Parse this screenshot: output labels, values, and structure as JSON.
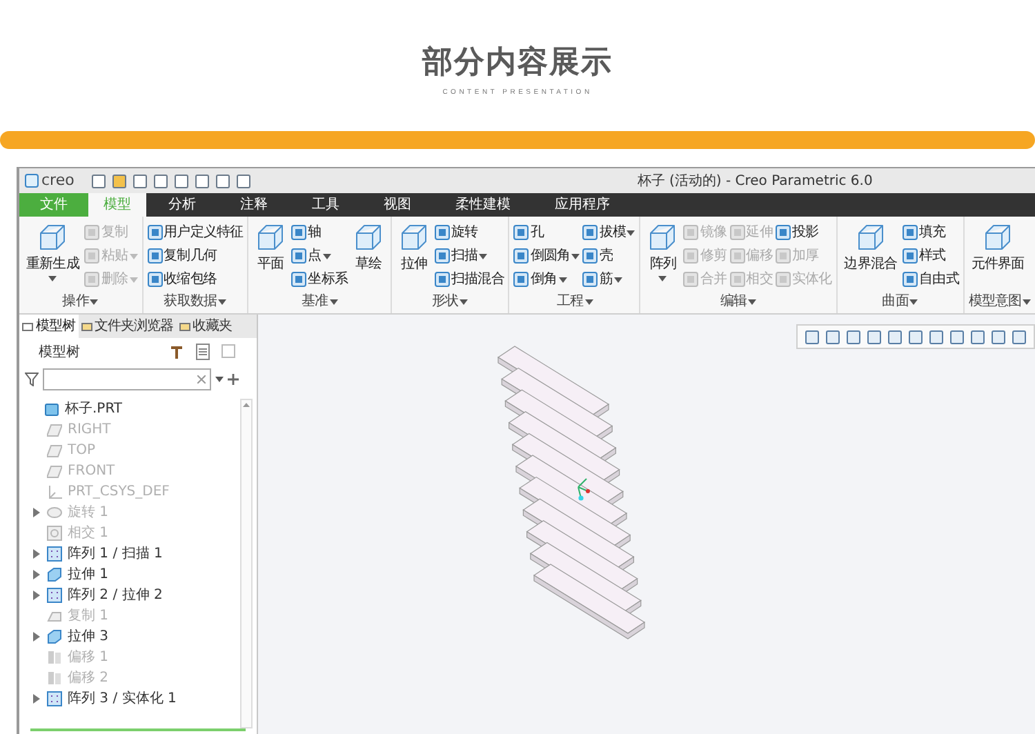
{
  "header": {
    "title": "部分内容展示",
    "subtitle": "CONTENT PRESENTATION"
  },
  "window": {
    "logo": "creo",
    "title": "杯子 (活动的) - Creo Parametric 6.0"
  },
  "tabs": [
    {
      "label": "文件",
      "kind": "file",
      "selected": false
    },
    {
      "label": "模型",
      "kind": "tab",
      "selected": true
    },
    {
      "label": "分析",
      "kind": "tab",
      "selected": false
    },
    {
      "label": "注释",
      "kind": "tab",
      "selected": false
    },
    {
      "label": "工具",
      "kind": "tab",
      "selected": false
    },
    {
      "label": "视图",
      "kind": "tab",
      "selected": false
    },
    {
      "label": "柔性建模",
      "kind": "tab",
      "selected": false
    },
    {
      "label": "应用程序",
      "kind": "tab",
      "selected": false
    }
  ],
  "ribbon": [
    {
      "label": "操作",
      "columns": [
        [
          {
            "label": "重新生成",
            "kind": "large",
            "dropdown": true,
            "disabled": false
          }
        ],
        [
          {
            "label": "复制",
            "kind": "small",
            "dropdown": false,
            "disabled": true
          },
          {
            "label": "粘贴",
            "kind": "small",
            "dropdown": true,
            "disabled": true
          },
          {
            "label": "删除",
            "kind": "small",
            "dropdown": true,
            "disabled": true
          }
        ]
      ]
    },
    {
      "label": "获取数据",
      "columns": [
        [
          {
            "label": "用户定义特征",
            "kind": "small",
            "dropdown": false,
            "disabled": false
          },
          {
            "label": "复制几何",
            "kind": "small",
            "dropdown": false,
            "disabled": false
          },
          {
            "label": "收缩包络",
            "kind": "small",
            "dropdown": false,
            "disabled": false
          }
        ]
      ]
    },
    {
      "label": "基准",
      "columns": [
        [
          {
            "label": "平面",
            "kind": "large",
            "dropdown": false,
            "disabled": false
          }
        ],
        [
          {
            "label": "轴",
            "kind": "small",
            "dropdown": false,
            "disabled": false
          },
          {
            "label": "点",
            "kind": "small",
            "dropdown": true,
            "disabled": false
          },
          {
            "label": "坐标系",
            "kind": "small",
            "dropdown": false,
            "disabled": false
          }
        ],
        [
          {
            "label": "草绘",
            "kind": "large",
            "dropdown": false,
            "disabled": false
          }
        ]
      ]
    },
    {
      "label": "形状",
      "columns": [
        [
          {
            "label": "拉伸",
            "kind": "large",
            "dropdown": false,
            "disabled": false
          }
        ],
        [
          {
            "label": "旋转",
            "kind": "small",
            "dropdown": false,
            "disabled": false
          },
          {
            "label": "扫描",
            "kind": "small",
            "dropdown": true,
            "disabled": false
          },
          {
            "label": "扫描混合",
            "kind": "small",
            "dropdown": false,
            "disabled": false
          }
        ]
      ]
    },
    {
      "label": "工程",
      "columns": [
        [
          {
            "label": "孔",
            "kind": "small",
            "dropdown": false,
            "disabled": false
          },
          {
            "label": "倒圆角",
            "kind": "small",
            "dropdown": true,
            "disabled": false
          },
          {
            "label": "倒角",
            "kind": "small",
            "dropdown": true,
            "disabled": false
          }
        ],
        [
          {
            "label": "拔模",
            "kind": "small",
            "dropdown": true,
            "disabled": false
          },
          {
            "label": "壳",
            "kind": "small",
            "dropdown": false,
            "disabled": false
          },
          {
            "label": "筋",
            "kind": "small",
            "dropdown": true,
            "disabled": false
          }
        ]
      ]
    },
    {
      "label": "编辑",
      "columns": [
        [
          {
            "label": "阵列",
            "kind": "large",
            "dropdown": true,
            "disabled": false
          }
        ],
        [
          {
            "label": "镜像",
            "kind": "small",
            "dropdown": false,
            "disabled": true
          },
          {
            "label": "修剪",
            "kind": "small",
            "dropdown": false,
            "disabled": true
          },
          {
            "label": "合并",
            "kind": "small",
            "dropdown": false,
            "disabled": true
          }
        ],
        [
          {
            "label": "延伸",
            "kind": "small",
            "dropdown": false,
            "disabled": true
          },
          {
            "label": "偏移",
            "kind": "small",
            "dropdown": false,
            "disabled": true
          },
          {
            "label": "相交",
            "kind": "small",
            "dropdown": false,
            "disabled": true
          }
        ],
        [
          {
            "label": "投影",
            "kind": "small",
            "dropdown": false,
            "disabled": false
          },
          {
            "label": "加厚",
            "kind": "small",
            "dropdown": false,
            "disabled": true
          },
          {
            "label": "实体化",
            "kind": "small",
            "dropdown": false,
            "disabled": true
          }
        ]
      ]
    },
    {
      "label": "曲面",
      "columns": [
        [
          {
            "label": "边界混合",
            "kind": "large",
            "dropdown": false,
            "disabled": false
          }
        ],
        [
          {
            "label": "填充",
            "kind": "small",
            "dropdown": false,
            "disabled": false
          },
          {
            "label": "样式",
            "kind": "small",
            "dropdown": false,
            "disabled": false
          },
          {
            "label": "自由式",
            "kind": "small",
            "dropdown": false,
            "disabled": false
          }
        ]
      ]
    },
    {
      "label": "模型意图",
      "columns": [
        [
          {
            "label": "元件界面",
            "kind": "large",
            "dropdown": false,
            "disabled": false
          }
        ]
      ]
    }
  ],
  "panel": {
    "tabs": [
      {
        "label": "模型树",
        "selected": true
      },
      {
        "label": "文件夹浏览器",
        "selected": false
      },
      {
        "label": "收藏夹",
        "selected": false
      }
    ],
    "title": "模型树",
    "tree": [
      {
        "label": "杯子.PRT",
        "kind": "part",
        "disabled": false,
        "expandable": false,
        "children": [
          {
            "label": "RIGHT",
            "kind": "plane",
            "disabled": true,
            "expandable": false
          },
          {
            "label": "TOP",
            "kind": "plane",
            "disabled": true,
            "expandable": false
          },
          {
            "label": "FRONT",
            "kind": "plane",
            "disabled": true,
            "expandable": false
          },
          {
            "label": "PRT_CSYS_DEF",
            "kind": "csys",
            "disabled": true,
            "expandable": false
          },
          {
            "label": "旋转 1",
            "kind": "revolve",
            "disabled": true,
            "expandable": true
          },
          {
            "label": "相交 1",
            "kind": "feature",
            "disabled": true,
            "expandable": false
          },
          {
            "label": "阵列 1 / 扫描 1",
            "kind": "pattern",
            "disabled": false,
            "expandable": true
          },
          {
            "label": "拉伸 1",
            "kind": "extrude",
            "disabled": false,
            "expandable": true
          },
          {
            "label": "阵列 2 / 拉伸 2",
            "kind": "pattern",
            "disabled": false,
            "expandable": true
          },
          {
            "label": "复制 1",
            "kind": "copy",
            "disabled": true,
            "expandable": false
          },
          {
            "label": "拉伸 3",
            "kind": "extrude",
            "disabled": false,
            "expandable": true
          },
          {
            "label": "偏移 1",
            "kind": "offset",
            "disabled": true,
            "expandable": false
          },
          {
            "label": "偏移 2",
            "kind": "offset",
            "disabled": true,
            "expandable": false
          },
          {
            "label": "阵列 3 / 实体化 1",
            "kind": "pattern",
            "disabled": false,
            "expandable": true
          }
        ]
      }
    ]
  }
}
